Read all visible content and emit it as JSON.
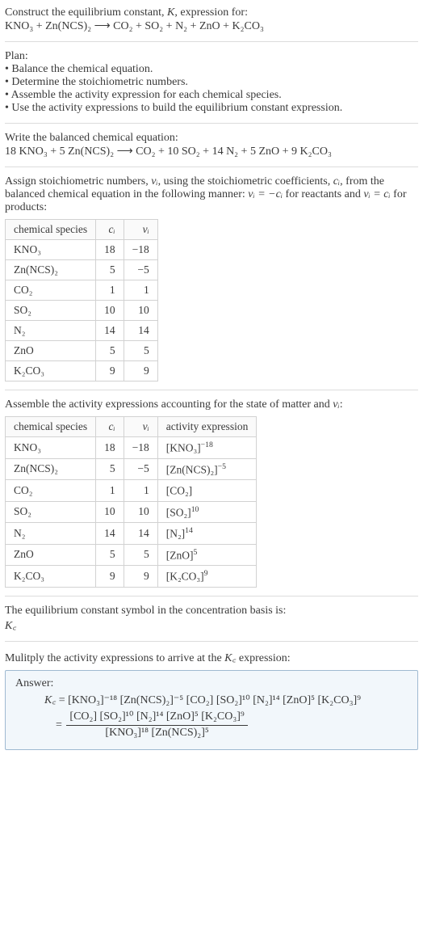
{
  "intro": {
    "line1_a": "Construct the equilibrium constant, ",
    "line1_k": "K",
    "line1_b": ", expression for:",
    "equation": "KNO₃ + Zn(NCS)₂  ⟶  CO₂ + SO₂ + N₂ + ZnO + K₂CO₃"
  },
  "plan": {
    "heading": "Plan:",
    "items": [
      "Balance the chemical equation.",
      "Determine the stoichiometric numbers.",
      "Assemble the activity expression for each chemical species.",
      "Use the activity expressions to build the equilibrium constant expression."
    ]
  },
  "balanced": {
    "heading": "Write the balanced chemical equation:",
    "equation": "18 KNO₃ + 5 Zn(NCS)₂  ⟶  CO₂ + 10 SO₂ + 14 N₂ + 5 ZnO + 9 K₂CO₃"
  },
  "assign": {
    "text_a": "Assign stoichiometric numbers, ",
    "nu": "νᵢ",
    "text_b": ", using the stoichiometric coefficients, ",
    "ci": "cᵢ",
    "text_c": ", from the balanced chemical equation in the following manner: ",
    "rel1": "νᵢ = −cᵢ",
    "text_d": " for reactants and ",
    "rel2": "νᵢ = cᵢ",
    "text_e": " for products:"
  },
  "table1": {
    "headers": [
      "chemical species",
      "cᵢ",
      "νᵢ"
    ],
    "rows": [
      [
        "KNO₃",
        "18",
        "−18"
      ],
      [
        "Zn(NCS)₂",
        "5",
        "−5"
      ],
      [
        "CO₂",
        "1",
        "1"
      ],
      [
        "SO₂",
        "10",
        "10"
      ],
      [
        "N₂",
        "14",
        "14"
      ],
      [
        "ZnO",
        "5",
        "5"
      ],
      [
        "K₂CO₃",
        "9",
        "9"
      ]
    ]
  },
  "assemble": {
    "text_a": "Assemble the activity expressions accounting for the state of matter and ",
    "nu": "νᵢ",
    "text_b": ":"
  },
  "table2": {
    "headers": [
      "chemical species",
      "cᵢ",
      "νᵢ",
      "activity expression"
    ],
    "rows": [
      {
        "sp": "KNO₃",
        "c": "18",
        "n": "−18",
        "ae_base": "[KNO₃]",
        "ae_exp": "−18"
      },
      {
        "sp": "Zn(NCS)₂",
        "c": "5",
        "n": "−5",
        "ae_base": "[Zn(NCS)₂]",
        "ae_exp": "−5"
      },
      {
        "sp": "CO₂",
        "c": "1",
        "n": "1",
        "ae_base": "[CO₂]",
        "ae_exp": ""
      },
      {
        "sp": "SO₂",
        "c": "10",
        "n": "10",
        "ae_base": "[SO₂]",
        "ae_exp": "10"
      },
      {
        "sp": "N₂",
        "c": "14",
        "n": "14",
        "ae_base": "[N₂]",
        "ae_exp": "14"
      },
      {
        "sp": "ZnO",
        "c": "5",
        "n": "5",
        "ae_base": "[ZnO]",
        "ae_exp": "5"
      },
      {
        "sp": "K₂CO₃",
        "c": "9",
        "n": "9",
        "ae_base": "[K₂CO₃]",
        "ae_exp": "9"
      }
    ]
  },
  "kc_symbol": {
    "line1": "The equilibrium constant symbol in the concentration basis is:",
    "kc": "K꜀"
  },
  "multiply": {
    "text_a": "Mulitply the activity expressions to arrive at the ",
    "kc": "K꜀",
    "text_b": " expression:"
  },
  "answer": {
    "label": "Answer:",
    "kc": "K꜀",
    "eq1": " = [KNO₃]⁻¹⁸ [Zn(NCS)₂]⁻⁵ [CO₂] [SO₂]¹⁰ [N₂]¹⁴ [ZnO]⁵ [K₂CO₃]⁹",
    "eq2_prefix": " = ",
    "frac_num": "[CO₂] [SO₂]¹⁰ [N₂]¹⁴ [ZnO]⁵ [K₂CO₃]⁹",
    "frac_den": "[KNO₃]¹⁸ [Zn(NCS)₂]⁵"
  },
  "chart_data": {
    "type": "table",
    "tables": [
      {
        "title": "stoichiometric numbers",
        "headers": [
          "chemical species",
          "c_i",
          "nu_i"
        ],
        "rows": [
          [
            "KNO3",
            18,
            -18
          ],
          [
            "Zn(NCS)2",
            5,
            -5
          ],
          [
            "CO2",
            1,
            1
          ],
          [
            "SO2",
            10,
            10
          ],
          [
            "N2",
            14,
            14
          ],
          [
            "ZnO",
            5,
            5
          ],
          [
            "K2CO3",
            9,
            9
          ]
        ]
      },
      {
        "title": "activity expressions",
        "headers": [
          "chemical species",
          "c_i",
          "nu_i",
          "activity expression"
        ],
        "rows": [
          [
            "KNO3",
            18,
            -18,
            "[KNO3]^-18"
          ],
          [
            "Zn(NCS)2",
            5,
            -5,
            "[Zn(NCS)2]^-5"
          ],
          [
            "CO2",
            1,
            1,
            "[CO2]"
          ],
          [
            "SO2",
            10,
            10,
            "[SO2]^10"
          ],
          [
            "N2",
            14,
            14,
            "[N2]^14"
          ],
          [
            "ZnO",
            5,
            5,
            "[ZnO]^5"
          ],
          [
            "K2CO3",
            9,
            9,
            "[K2CO3]^9"
          ]
        ]
      }
    ]
  }
}
